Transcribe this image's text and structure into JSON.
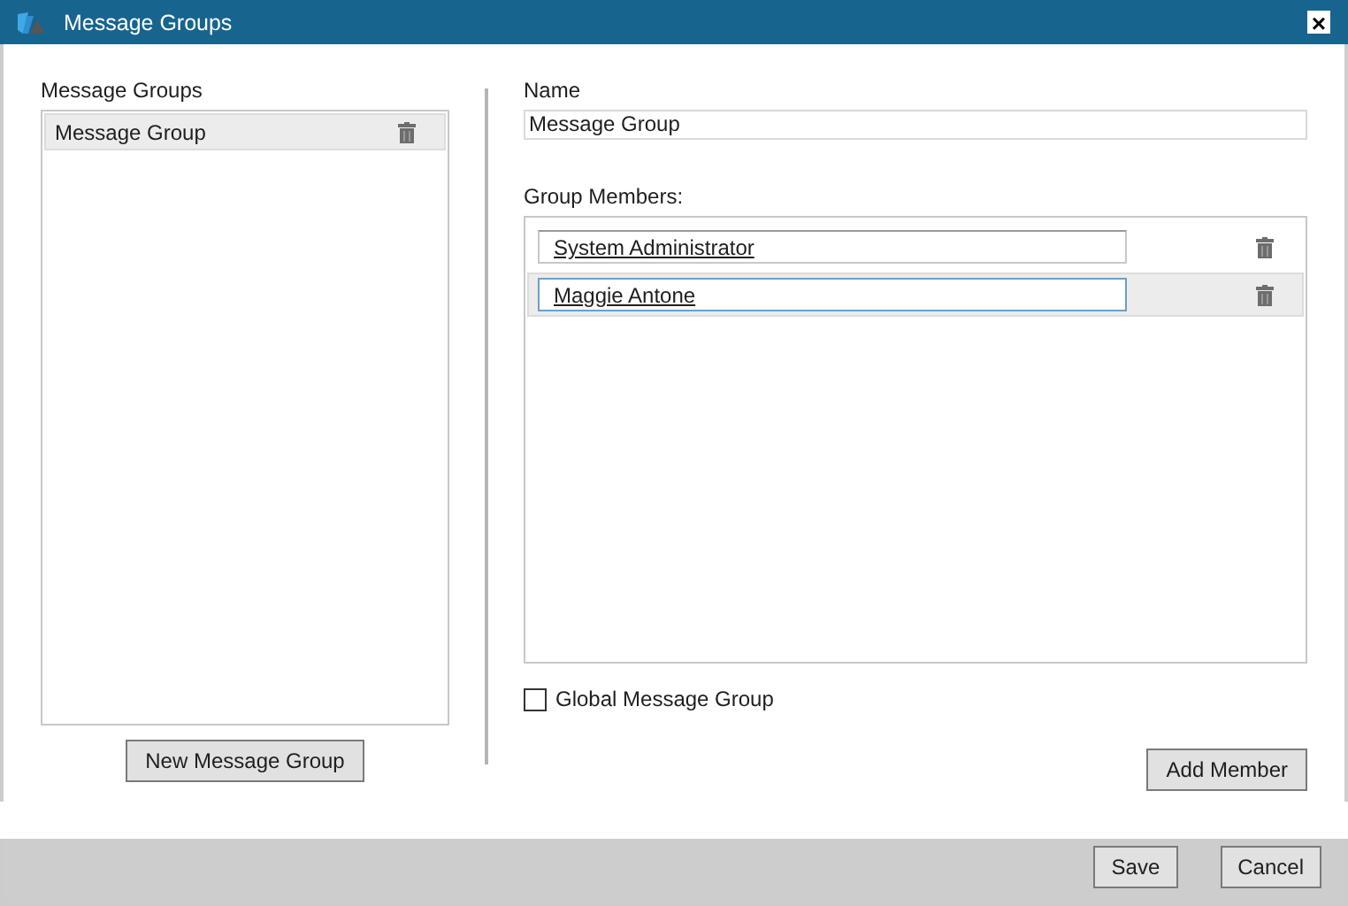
{
  "window": {
    "title": "Message Groups",
    "close": "×"
  },
  "groups": {
    "label": "Message Groups",
    "items": [
      {
        "name": "Message Group",
        "selected": true
      }
    ],
    "new_button": "New Message Group"
  },
  "name": {
    "label": "Name",
    "value": "Message Group"
  },
  "members": {
    "label": "Group Members:",
    "items": [
      {
        "name": "System Administrator",
        "selected": false
      },
      {
        "name": "Maggie Antone",
        "selected": true
      }
    ]
  },
  "global": {
    "label": "Global Message Group",
    "checked": false
  },
  "add_button": "Add Member",
  "footer": {
    "save": "Save",
    "cancel": "Cancel"
  }
}
